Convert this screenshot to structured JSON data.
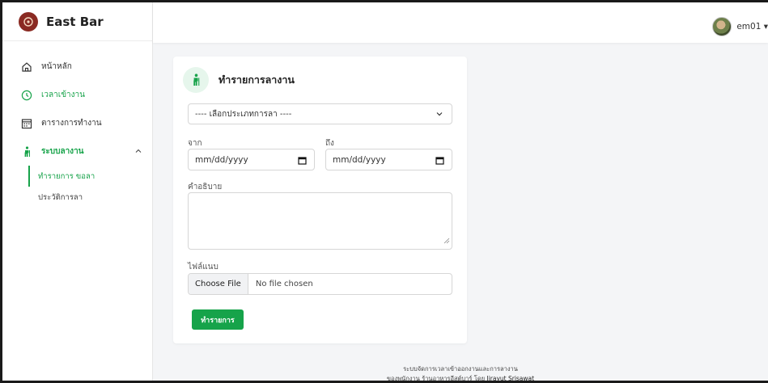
{
  "app": {
    "brand": "East Bar"
  },
  "sidebar": {
    "items": [
      {
        "label": "หน้าหลัก",
        "icon": "home-icon"
      },
      {
        "label": "เวลาเข้างาน",
        "icon": "clock-icon"
      },
      {
        "label": "ตารางการทำงาน",
        "icon": "calendar-icon"
      },
      {
        "label": "ระบบลางาน",
        "icon": "person-walking-icon"
      }
    ],
    "subitems": [
      {
        "label": "ทำรายการ ขอลา",
        "active": true
      },
      {
        "label": "ประวัติการลา",
        "active": false
      }
    ]
  },
  "topbar": {
    "username": "em01 ▾"
  },
  "form": {
    "title": "ทำรายการลางาน",
    "leave_type_placeholder": "---- เลือกประเภทการลา ----",
    "from_label": "จาก",
    "to_label": "ถึง",
    "from_value": "mm/dd/yyyy",
    "to_value": "mm/dd/yyyy",
    "description_label": "คำอธิบาย",
    "attachment_label": "ไฟล์แนบ",
    "file_button": "Choose File",
    "file_status": "No file chosen",
    "submit_label": "ทำรายการ"
  },
  "footer": {
    "line1": "ระบบจัดการเวลาเข้าออกงานและการลางาน",
    "line2_prefix": "ของพนักงาน ร้านอาหารอีสต์บาร์ โดย ",
    "author": "Jirayut Srisawat"
  },
  "colors": {
    "accent": "#16a34a",
    "brand_logo": "#8a2a22",
    "background": "#f4f5f7"
  }
}
